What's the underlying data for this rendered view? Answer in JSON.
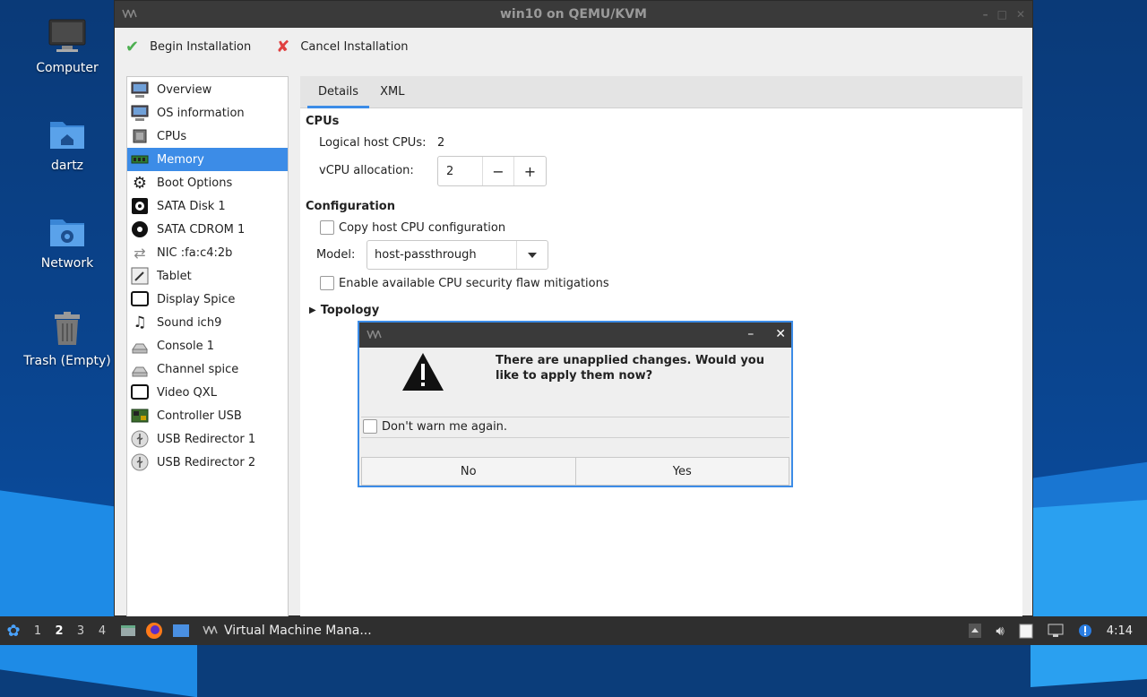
{
  "desktop": {
    "icons": [
      {
        "label": "Computer"
      },
      {
        "label": "dartz"
      },
      {
        "label": "Network"
      },
      {
        "label": "Trash (Empty)"
      }
    ]
  },
  "window": {
    "title": "win10 on QEMU/KVM",
    "toolbar": {
      "begin_label": "Begin Installation",
      "cancel_label": "Cancel Installation"
    },
    "sidebar": {
      "items": [
        {
          "label": "Overview",
          "icon": "monitor-icon"
        },
        {
          "label": "OS information",
          "icon": "monitor-icon"
        },
        {
          "label": "CPUs",
          "icon": "cpu-icon"
        },
        {
          "label": "Memory",
          "icon": "memory-icon",
          "selected": true
        },
        {
          "label": "Boot Options",
          "icon": "gear-icon"
        },
        {
          "label": "SATA Disk 1",
          "icon": "disk-icon"
        },
        {
          "label": "SATA CDROM 1",
          "icon": "cdrom-icon"
        },
        {
          "label": "NIC :fa:c4:2b",
          "icon": "network-icon"
        },
        {
          "label": "Tablet",
          "icon": "tablet-icon"
        },
        {
          "label": "Display Spice",
          "icon": "display-icon"
        },
        {
          "label": "Sound ich9",
          "icon": "sound-icon"
        },
        {
          "label": "Console 1",
          "icon": "console-icon"
        },
        {
          "label": "Channel spice",
          "icon": "channel-icon"
        },
        {
          "label": "Video QXL",
          "icon": "video-icon"
        },
        {
          "label": "Controller USB",
          "icon": "controller-icon"
        },
        {
          "label": "USB Redirector 1",
          "icon": "usb-icon"
        },
        {
          "label": "USB Redirector 2",
          "icon": "usb-icon"
        }
      ]
    },
    "tabs": [
      {
        "label": "Details",
        "active": true
      },
      {
        "label": "XML"
      }
    ],
    "cpus": {
      "section_title": "CPUs",
      "logical_label": "Logical host CPUs:",
      "logical_value": "2",
      "vcpu_label": "vCPU allocation:",
      "vcpu_value": "2",
      "minus": "−",
      "plus": "+"
    },
    "configuration": {
      "section_title": "Configuration",
      "copy_host_label": "Copy host CPU configuration",
      "model_label": "Model:",
      "model_value": "host-passthrough",
      "mitigations_label": "Enable available CPU security flaw mitigations"
    },
    "topology": {
      "label": "Topology"
    }
  },
  "dialog": {
    "message": "There are unapplied changes. Would you like to apply them now?",
    "dont_warn_label": "Don't warn me again.",
    "no_label": "No",
    "yes_label": "Yes",
    "minimize": "–",
    "close": "✕"
  },
  "taskbar": {
    "workspaces": [
      "1",
      "2",
      "3",
      "4"
    ],
    "active_workspace": "2",
    "app_label": "Virtual Machine Mana...",
    "clock": "4:14"
  },
  "colors": {
    "accent": "#3c8ce7",
    "titlebar": "#3a3a3a",
    "taskbar": "#2f2f2f"
  }
}
